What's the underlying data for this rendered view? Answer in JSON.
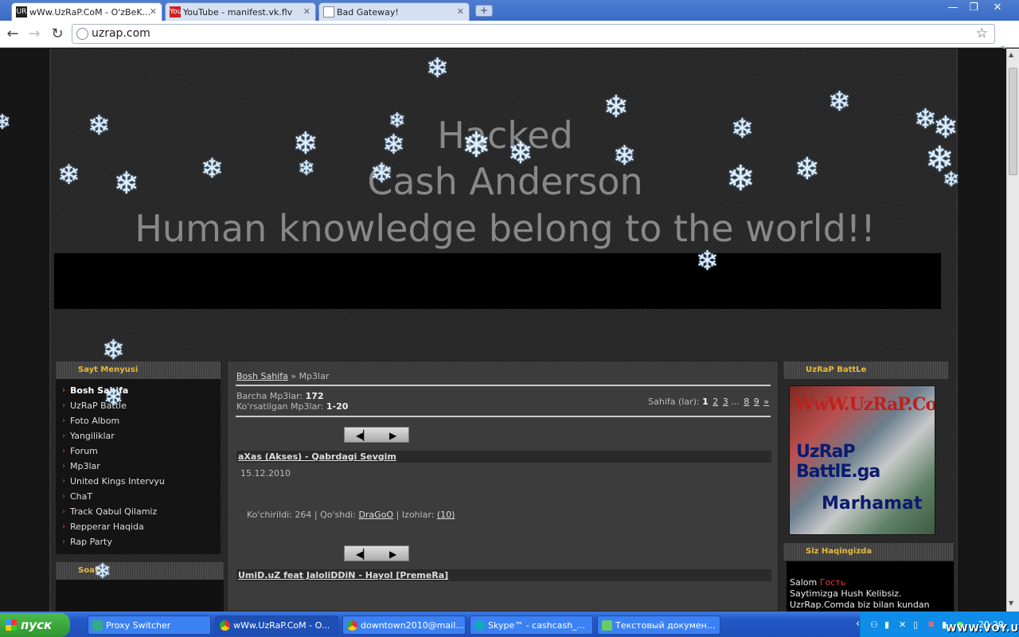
{
  "browser": {
    "tabs": [
      {
        "label": "wWw.UzRaP.CoM - O'zBeK...",
        "favicon": "UR"
      },
      {
        "label": "YouTube - manifest.vk.flv",
        "favicon": "You"
      },
      {
        "label": "Bad Gateway!",
        "favicon": "doc"
      }
    ],
    "url": "uzrap.com"
  },
  "hack_message": {
    "line1": "Hacked",
    "line2": "Cash Anderson",
    "line3": "Human knowledge belong to the world!!"
  },
  "left_menu": {
    "title": "Sayt Menyusi",
    "items": [
      "Bosh Sahifa",
      "UzRaP Battle",
      "Foto Albom",
      "Yangiliklar",
      "Forum",
      "Mp3lar",
      "United Kings Intervyu",
      "ChaT",
      "Track Qabul Qilamiz",
      "Repperar Haqida",
      "Rap Party"
    ],
    "soat_title": "Soat"
  },
  "content": {
    "breadcrumb_home": "Bosh Sahifa",
    "breadcrumb_sep": "»",
    "breadcrumb_current": "Mp3lar",
    "total_label": "Barcha Mp3lar:",
    "total_value": "172",
    "shown_label": "Ko'rsatilgan Mp3lar:",
    "shown_value": "1-20",
    "pages_label": "Sahifa (lar):",
    "pages": [
      "1",
      "2",
      "3",
      "...",
      "8",
      "9",
      "»"
    ],
    "tracks": [
      {
        "title": "aXas (Akses) - Qabrdagi Sevgim",
        "date": "15.12.2010",
        "downloads_label": "Ko'chirildi: 264",
        "added_label": "Qo'shdi:",
        "added_by": "DraGoO",
        "comments_label": "Izohlar:",
        "comments": "(10)"
      },
      {
        "title": "UmiD.uZ feat JaloliDDiN - Hayol [PremeRa]"
      }
    ]
  },
  "right": {
    "battle_title": "UzRaP BattLe",
    "banner_line1": "WwW.UzRaP.CoM",
    "banner_line2": "UzRaP BattlE.ga",
    "banner_line3": "Marhamat",
    "siz_title": "Siz Haqingizda",
    "greeting": "Salom",
    "guest": "Гость",
    "welcome": "Saytimizga Hush Kelibsiz.",
    "welcome2": "UzrRap.Comda biz bilan kundan"
  },
  "taskbar": {
    "start": "пуск",
    "tasks": [
      "Proxy Switcher",
      "wWw.UzRaP.CoM - O...",
      "downtown2010@mail....",
      "Skype™ - cashcash_...",
      "Текстовый докумен..."
    ],
    "clock": "20:20",
    "watermark": "WWW.VOY.UZ"
  },
  "colors": {
    "accent_gold": "#e7b93b",
    "guest_red": "#ee3333",
    "chrome_blue": "#3a6bc4"
  }
}
